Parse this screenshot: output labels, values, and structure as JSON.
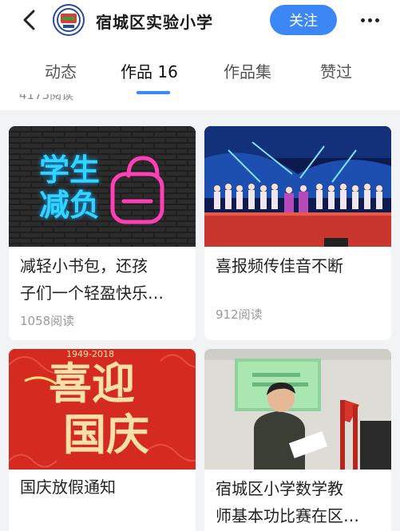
{
  "header": {
    "account_name": "宿城区实验小学",
    "follow_label": "关注"
  },
  "tabs": [
    {
      "label": "动态"
    },
    {
      "label": "作品 16"
    },
    {
      "label": "作品集"
    },
    {
      "label": "赞过"
    }
  ],
  "previous_row": {
    "views_left": "4175阅读"
  },
  "cards": [
    {
      "title_line1": "减轻小书包，还孩",
      "title_line2": "子们一个轻盈快乐…",
      "views": "1058阅读",
      "thumb_text1": "学生",
      "thumb_text2": "减负"
    },
    {
      "title_line1": "喜报频传佳音不断",
      "views": "912阅读"
    },
    {
      "title_line1": "国庆放假通知",
      "thumb_year": "1949-2018",
      "thumb_text1": "喜迎",
      "thumb_text2": "国庆"
    },
    {
      "title_line1": "宿城区小学数学教",
      "title_line2": "师基本功比赛在区…"
    }
  ]
}
